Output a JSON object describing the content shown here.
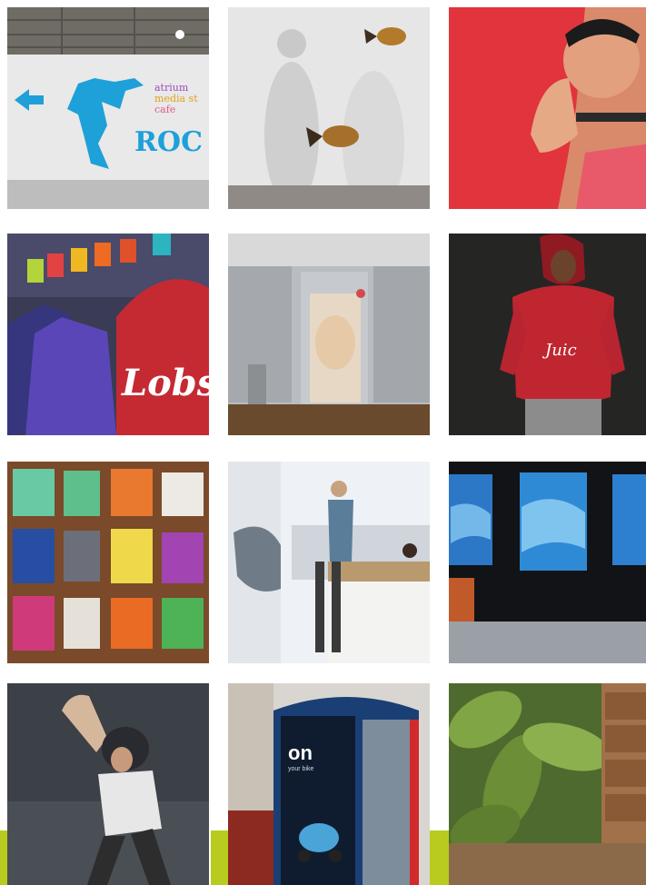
{
  "tiles": {
    "t1": {
      "wall_words": [
        "atrium",
        "media st",
        "cafe"
      ],
      "big_word": "ROC"
    },
    "t5": {},
    "t6": {
      "hoodie_text": "Juic"
    },
    "t4": {
      "sign_text": "Lobs"
    },
    "t11": {
      "poster_title": "on",
      "poster_sub": "your bike"
    }
  },
  "colors": {
    "green_accent": "#b7cc1e",
    "cyan": "#1ea0d8"
  }
}
